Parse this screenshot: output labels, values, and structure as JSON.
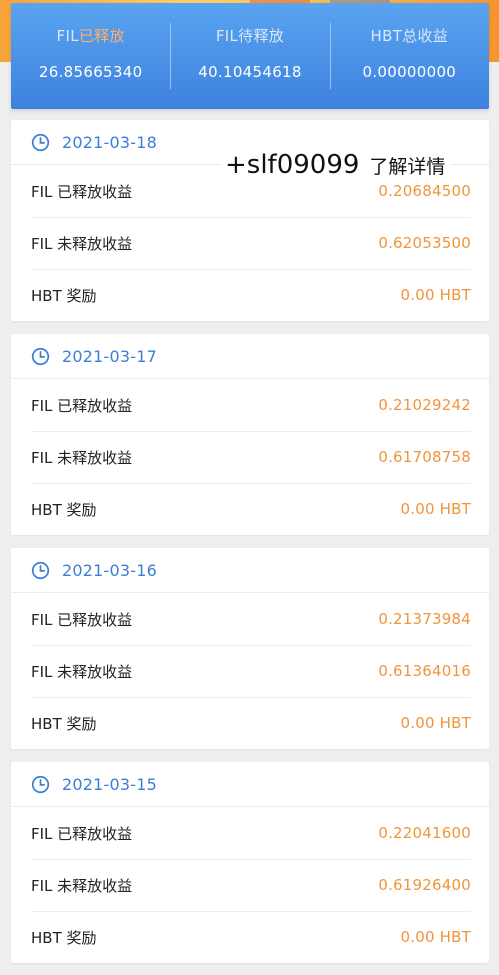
{
  "summary": {
    "released": {
      "label_prefix": "FIL",
      "label_suffix": "已释放",
      "value": "26.85665340"
    },
    "pending": {
      "label": "FIL待释放",
      "value": "40.10454618"
    },
    "hbt_total": {
      "label": "HBT总收益",
      "value": "0.00000000"
    }
  },
  "days": [
    {
      "date": "2021-03-18",
      "rows": [
        {
          "label": "FIL 已释放收益",
          "value": "0.20684500"
        },
        {
          "label": "FIL 未释放收益",
          "value": "0.62053500"
        },
        {
          "label": "HBT 奖励",
          "value": "0.00 HBT"
        }
      ]
    },
    {
      "date": "2021-03-17",
      "rows": [
        {
          "label": "FIL 已释放收益",
          "value": "0.21029242"
        },
        {
          "label": "FIL 未释放收益",
          "value": "0.61708758"
        },
        {
          "label": "HBT 奖励",
          "value": "0.00 HBT"
        }
      ]
    },
    {
      "date": "2021-03-16",
      "rows": [
        {
          "label": "FIL 已释放收益",
          "value": "0.21373984"
        },
        {
          "label": "FIL 未释放收益",
          "value": "0.61364016"
        },
        {
          "label": "HBT 奖励",
          "value": "0.00 HBT"
        }
      ]
    },
    {
      "date": "2021-03-15",
      "rows": [
        {
          "label": "FIL 已释放收益",
          "value": "0.22041600"
        },
        {
          "label": "FIL 未释放收益",
          "value": "0.61926400"
        },
        {
          "label": "HBT 奖励",
          "value": "0.00 HBT"
        }
      ]
    }
  ],
  "overlay": {
    "contact": "+slf09099",
    "cta": "了解详情"
  },
  "colors": {
    "accent_blue": "#3a7fd5",
    "value_orange": "#f0953a",
    "header_blue": "#4a90e6"
  },
  "icons": {
    "date": "clock-icon"
  }
}
